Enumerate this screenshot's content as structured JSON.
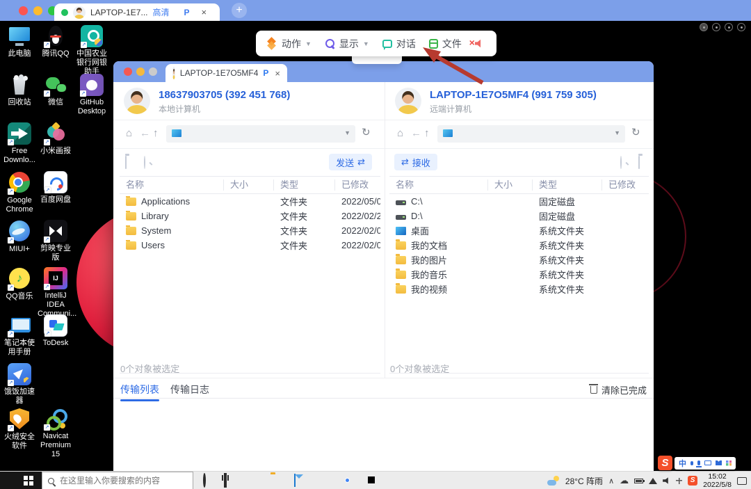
{
  "host": {
    "tab_title": "LAPTOP-1E7...",
    "tab_quality": "高清",
    "tab_p": "P",
    "tab_close": "×",
    "new_tab": "+"
  },
  "toolbar": {
    "action": "动作",
    "display": "显示",
    "chat": "对话",
    "file": "文件"
  },
  "desktop_icons": [
    {
      "label": "此电脑"
    },
    {
      "label": "腾讯QQ"
    },
    {
      "label": "中国农业银行网银助手"
    },
    {
      "label": "回收站"
    },
    {
      "label": "微信"
    },
    {
      "label": "GitHub Desktop"
    },
    {
      "label": "Free Downlo..."
    },
    {
      "label": "小米画报"
    },
    {
      "label": "Google Chrome"
    },
    {
      "label": "百度网盘"
    },
    {
      "label": "MIUI+"
    },
    {
      "label": "剪映专业版"
    },
    {
      "label": "QQ音乐"
    },
    {
      "label": "IntelliJ IDEA Communi..."
    },
    {
      "label": "笔记本使用手册"
    },
    {
      "label": "ToDesk"
    },
    {
      "label": "饿饭加速器"
    },
    {
      "label": "火绒安全软件"
    },
    {
      "label": "Navicat Premium 15"
    }
  ],
  "file_window": {
    "tab_title": "LAPTOP-1E7O5MF4",
    "tab_p": "P",
    "tab_close": "×",
    "local": {
      "name": "18637903705 (392 451 768)",
      "subtitle": "本地计算机",
      "action": "发送",
      "status": "0个对象被选定",
      "headers": [
        "名称",
        "大小",
        "类型",
        "已修改"
      ],
      "rows": [
        {
          "name": "Applications",
          "size": "",
          "type": "文件夹",
          "modified": "2022/05/0..."
        },
        {
          "name": "Library",
          "size": "",
          "type": "文件夹",
          "modified": "2022/02/2..."
        },
        {
          "name": "System",
          "size": "",
          "type": "文件夹",
          "modified": "2022/02/0..."
        },
        {
          "name": "Users",
          "size": "",
          "type": "文件夹",
          "modified": "2022/02/0..."
        }
      ]
    },
    "remote": {
      "name": "LAPTOP-1E7O5MF4 (991 759 305)",
      "subtitle": "远端计算机",
      "action": "接收",
      "status": "0个对象被选定",
      "headers": [
        "名称",
        "大小",
        "类型",
        "已修改"
      ],
      "rows": [
        {
          "name": "C:\\",
          "size": "",
          "type": "固定磁盘",
          "modified": ""
        },
        {
          "name": "D:\\",
          "size": "",
          "type": "固定磁盘",
          "modified": ""
        },
        {
          "name": "桌面",
          "size": "",
          "type": "系统文件夹",
          "modified": ""
        },
        {
          "name": "我的文档",
          "size": "",
          "type": "系统文件夹",
          "modified": ""
        },
        {
          "name": "我的图片",
          "size": "",
          "type": "系统文件夹",
          "modified": ""
        },
        {
          "name": "我的音乐",
          "size": "",
          "type": "系统文件夹",
          "modified": ""
        },
        {
          "name": "我的视频",
          "size": "",
          "type": "系统文件夹",
          "modified": ""
        }
      ]
    },
    "transfer_tabs": {
      "list": "传输列表",
      "log": "传输日志",
      "clear": "清除已完成"
    }
  },
  "taskbar": {
    "search_placeholder": "在这里输入你要搜索的内容",
    "weather": "28°C 阵雨",
    "time": "15:02",
    "date": "2022/5/8",
    "ime_mode": "中",
    "sogou_logo": "S"
  },
  "colors": {
    "accent_blue": "#2e6be5",
    "bar_blue": "#7c9fe9",
    "send_bg": "#e9f1fe",
    "folder_yellow": "#f3bb3f"
  }
}
